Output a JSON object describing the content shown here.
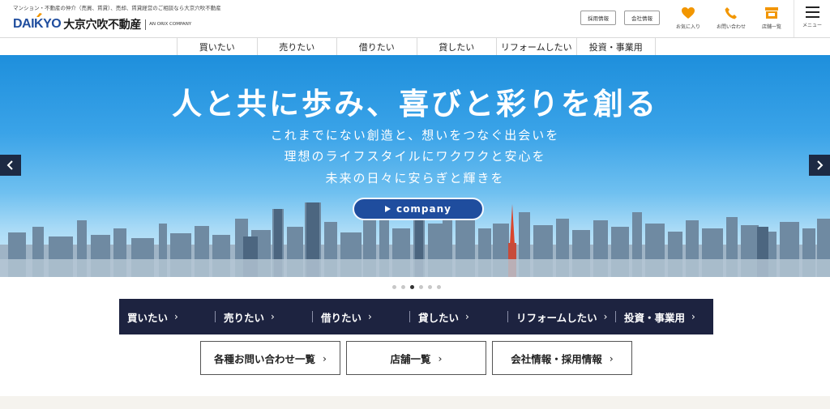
{
  "header": {
    "tagline": "マンション・不動産の仲介（売買、賃貸）、売却、賃貸経営のご相談なら大京穴吹不動産",
    "logo_mark": "DAIKYO",
    "logo_name": "大京穴吹不動産",
    "logo_sub": "AN ORIX COMPANY",
    "buttons": {
      "recruit": "採用情報",
      "company": "会社情報"
    },
    "icons": {
      "favorite": "お気に入り",
      "contact": "お問い合わせ",
      "stores": "店舗一覧",
      "menu": "メニュー"
    },
    "colors": {
      "icon_orange": "#f29600",
      "brand_blue": "#1f4d9e"
    }
  },
  "topnav": {
    "items": [
      "買いたい",
      "売りたい",
      "借りたい",
      "貸したい",
      "リフォームしたい",
      "投資・事業用"
    ]
  },
  "hero": {
    "title": "人と共に歩み、喜びと彩りを創る",
    "lines": [
      "これまでにない創造と、想いをつなぐ出会いを",
      "理想のライフスタイルにワクワクと安心を",
      "未来の日々に安らぎと輝きを"
    ],
    "button": "company",
    "slides_total": 6,
    "slide_active": 3
  },
  "categories": {
    "items": [
      "買いたい",
      "売りたい",
      "借りたい",
      "貸したい",
      "リフォームしたい",
      "投資・事業用"
    ],
    "chevron": "›"
  },
  "links": {
    "contact_list": "各種お問い合わせ一覧",
    "store_list": "店舗一覧",
    "company_recruit": "会社情報・採用情報",
    "chevron": "›"
  }
}
